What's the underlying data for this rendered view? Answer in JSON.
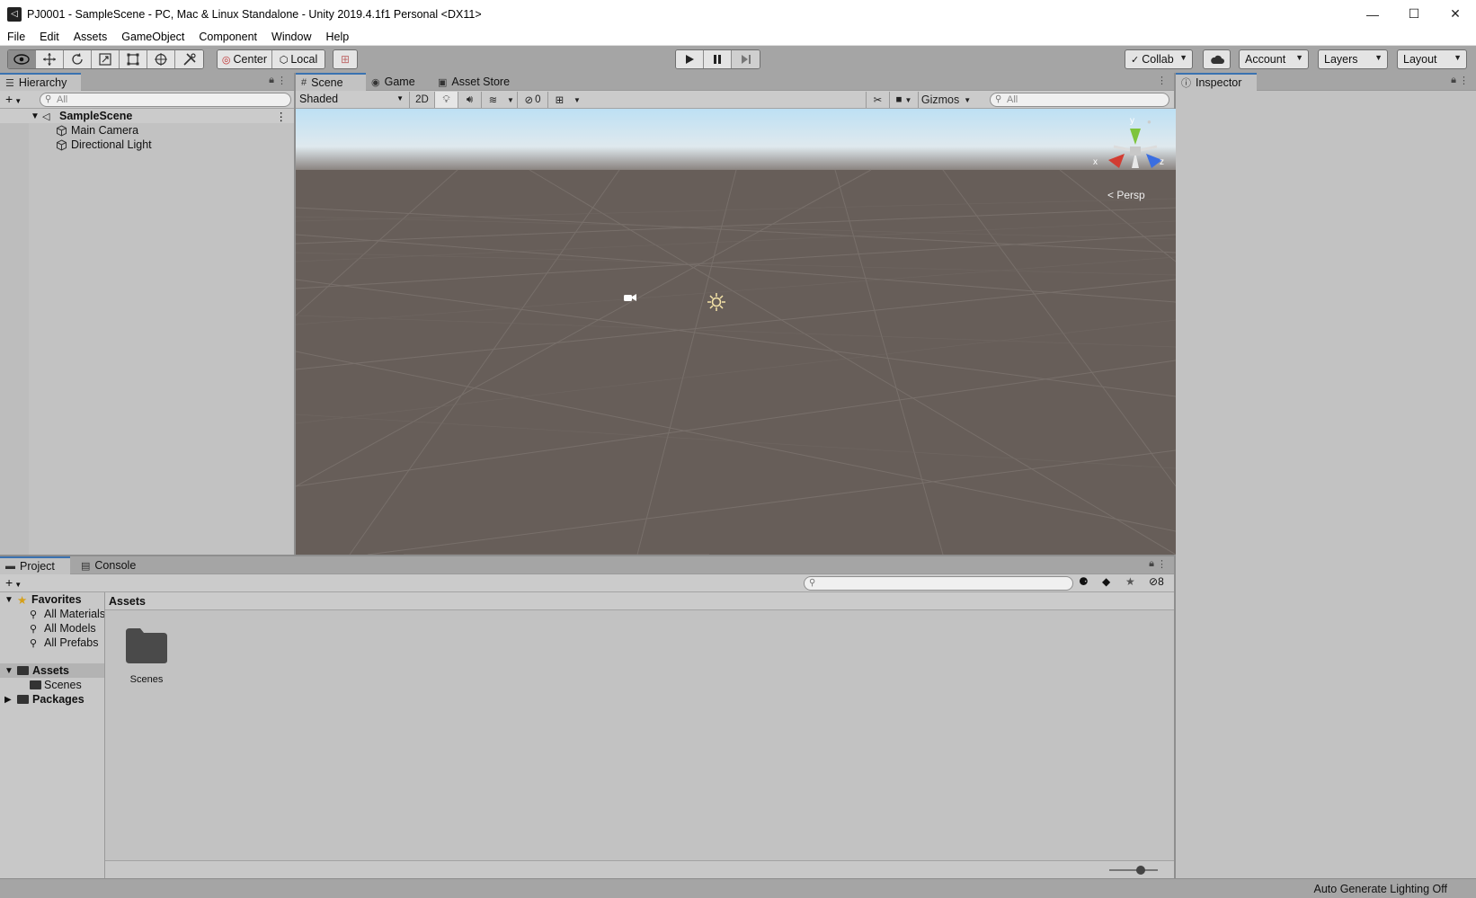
{
  "window": {
    "title": "PJ0001 - SampleScene - PC, Mac & Linux Standalone - Unity 2019.4.1f1 Personal <DX11>",
    "minimize": "—",
    "maximize": "☐",
    "close": "✕"
  },
  "menu": [
    "File",
    "Edit",
    "Assets",
    "GameObject",
    "Component",
    "Window",
    "Help"
  ],
  "toolbar": {
    "pivot_label": "Center",
    "space_label": "Local",
    "collab_label": "Collab",
    "account_label": "Account",
    "layers_label": "Layers",
    "layout_label": "Layout"
  },
  "hierarchy": {
    "tab_label": "Hierarchy",
    "search_placeholder": "All",
    "scene_name": "SampleScene",
    "objects": [
      "Main Camera",
      "Directional Light"
    ]
  },
  "scene": {
    "tabs": [
      "Scene",
      "Game",
      "Asset Store"
    ],
    "draw_mode": "Shaded",
    "toggle_2d": "2D",
    "hidden_count": "0",
    "gizmos_label": "Gizmos",
    "search_placeholder": "All",
    "projection_label": "Persp",
    "axis_x": "x",
    "axis_y": "y",
    "axis_z": "z"
  },
  "inspector": {
    "tab_label": "Inspector"
  },
  "project": {
    "tabs": [
      "Project",
      "Console"
    ],
    "favorites_label": "Favorites",
    "favorites": [
      "All Materials",
      "All Models",
      "All Prefabs"
    ],
    "assets_label": "Assets",
    "assets_children": [
      "Scenes"
    ],
    "packages_label": "Packages",
    "breadcrumb": "Assets",
    "hidden_count": "8",
    "items": [
      {
        "name": "Scenes",
        "icon": "folder-icon"
      }
    ]
  },
  "status": {
    "text": "Auto Generate Lighting Off"
  },
  "colors": {
    "panel": "#c2c2c2",
    "toolbar": "#a5a5a5",
    "active_tab_accent": "#3a72b0",
    "sky_top": "#bde0f4",
    "ground": "#675e59"
  }
}
